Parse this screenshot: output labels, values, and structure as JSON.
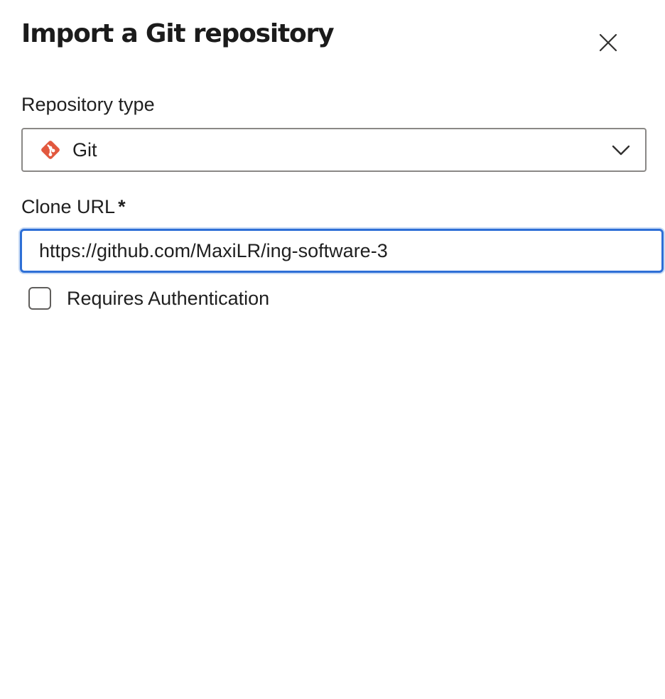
{
  "dialog": {
    "title": "Import a Git repository",
    "close_icon": "close-icon"
  },
  "repository_type": {
    "label": "Repository type",
    "selected_value": "Git",
    "icon": "git-logo-icon",
    "icon_color": "#e2583e",
    "chevron_icon": "chevron-down-icon"
  },
  "clone_url": {
    "label": "Clone URL",
    "required_mark": "*",
    "value": "https://github.com/MaxiLR/ing-software-3",
    "focus_color": "#2e6fd6"
  },
  "auth": {
    "label": "Requires Authentication",
    "checked": false
  }
}
